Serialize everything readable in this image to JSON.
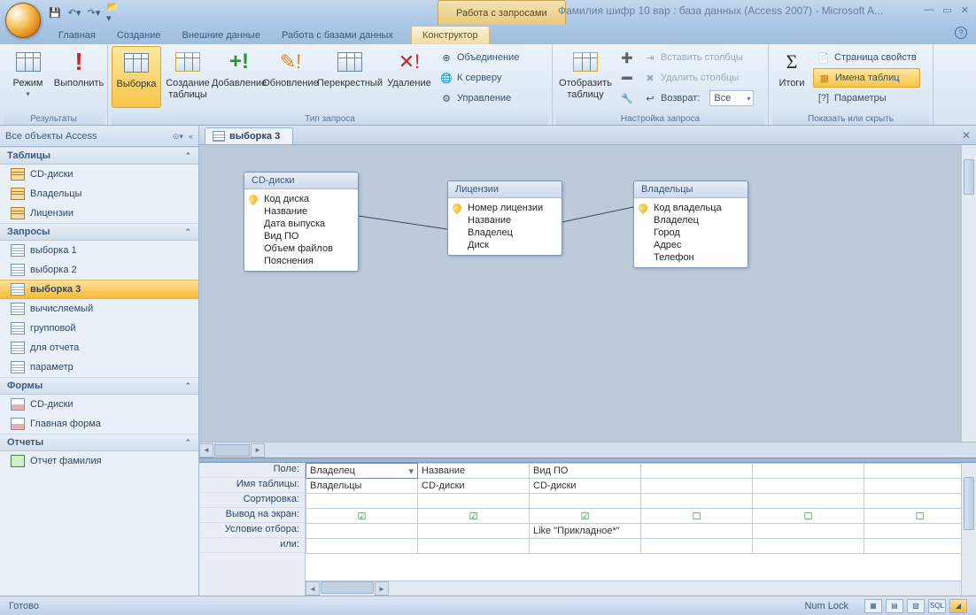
{
  "title_context": "Работа с запросами",
  "title": "Фамилия шифр 10 вар : база данных (Access 2007) - Microsoft A...",
  "tabs": {
    "home": "Главная",
    "create": "Создание",
    "external": "Внешние данные",
    "dbtools": "Работа с базами данных",
    "design": "Конструктор"
  },
  "ribbon": {
    "g1": {
      "label": "Результаты",
      "view": "Режим",
      "run": "Выполнить"
    },
    "g2": {
      "label": "Тип запроса",
      "select": "Выборка",
      "maketable": "Создание таблицы",
      "append": "Добавление",
      "update": "Обновление",
      "crosstab": "Перекрестный",
      "delete": "Удаление",
      "union": "Объединение",
      "passthrough": "К серверу",
      "datadef": "Управление"
    },
    "g3": {
      "label": "Настройка запроса",
      "showtable": "Отобразить таблицу",
      "inscol": "Вставить столбцы",
      "delcol": "Удалить столбцы",
      "return": "Возврат:",
      "return_val": "Все"
    },
    "g4": {
      "label": "Показать или скрыть",
      "totals": "Итоги",
      "propsheet": "Страница свойств",
      "tablenames": "Имена таблиц",
      "params": "Параметры"
    }
  },
  "nav": {
    "header": "Все объекты Access",
    "cat_tables": "Таблицы",
    "tables": [
      "CD-диски",
      "Владельцы",
      "Лицензии"
    ],
    "cat_queries": "Запросы",
    "queries": [
      "выборка 1",
      "выборка 2",
      "выборка 3",
      "вычисляемый",
      "групповой",
      "для отчета",
      "параметр"
    ],
    "cat_forms": "Формы",
    "forms": [
      "CD-диски",
      "Главная форма"
    ],
    "cat_reports": "Отчеты",
    "reports": [
      "Отчет фамилия"
    ]
  },
  "doc": {
    "tab": "выборка 3"
  },
  "designer": {
    "t1": {
      "title": "CD-диски",
      "fields": [
        "Код диска",
        "Название",
        "Дата выпуска",
        "Вид ПО",
        "Объем файлов",
        "Пояснения"
      ],
      "key": 0
    },
    "t2": {
      "title": "Лицензии",
      "fields": [
        "Номер лицензии",
        "Название",
        "Владелец",
        "Диск"
      ],
      "key": 0
    },
    "t3": {
      "title": "Владельцы",
      "fields": [
        "Код владельца",
        "Владелец",
        "Город",
        "Адрес",
        "Телефон"
      ],
      "key": 0
    }
  },
  "grid": {
    "rows": [
      "Поле:",
      "Имя таблицы:",
      "Сортировка:",
      "Вывод на экран:",
      "Условие отбора:",
      "или:"
    ],
    "cols": [
      {
        "field": "Владелец",
        "table": "Владельцы",
        "show": true,
        "criteria": ""
      },
      {
        "field": "Название",
        "table": "CD-диски",
        "show": true,
        "criteria": ""
      },
      {
        "field": "Вид ПО",
        "table": "CD-диски",
        "show": true,
        "criteria": "Like \"Прикладное*\""
      },
      {
        "field": "",
        "table": "",
        "show": false,
        "criteria": ""
      },
      {
        "field": "",
        "table": "",
        "show": false,
        "criteria": ""
      },
      {
        "field": "",
        "table": "",
        "show": false,
        "criteria": ""
      }
    ]
  },
  "status": {
    "ready": "Готово",
    "numlock": "Num Lock",
    "sql": "SQL"
  }
}
